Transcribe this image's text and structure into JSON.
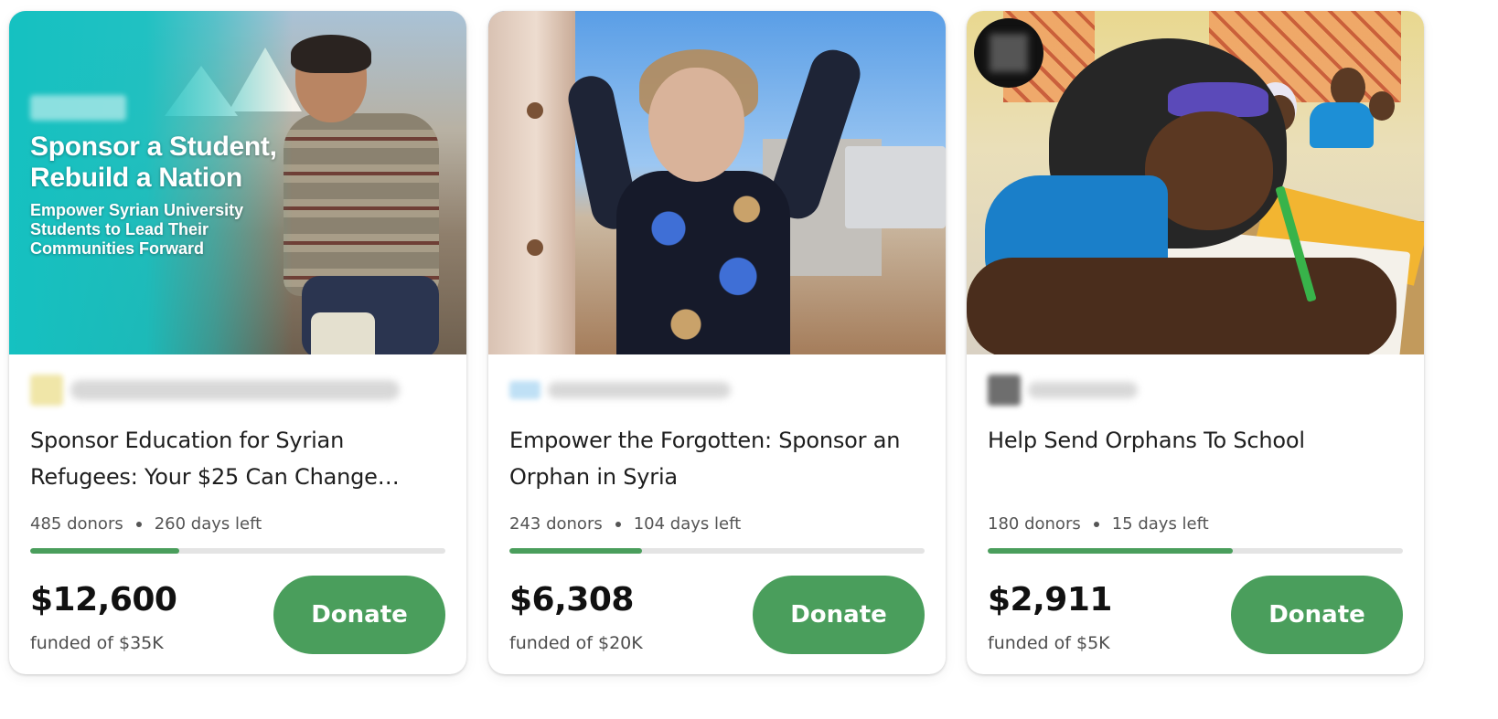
{
  "colors": {
    "accent_green": "#4a9e5c",
    "progress_track": "#e4e4e4",
    "teal": "#15c1c1"
  },
  "cards": [
    {
      "promo_title": "Sponsor a Student, Rebuild a Nation",
      "promo_subtitle": "Empower Syrian University Students to Lead Their Communities Forward",
      "title": "Sponsor Education for Syrian Refugees: Your $25 Can Change…",
      "donors": "485 donors",
      "days_left": "260 days left",
      "progress_fraction": 0.36,
      "amount": "$12,600",
      "goal": "funded of $35K",
      "donate_label": "Donate"
    },
    {
      "title": "Empower the Forgotten: Sponsor an Orphan in Syria",
      "donors": "243 donors",
      "days_left": "104 days left",
      "progress_fraction": 0.32,
      "amount": "$6,308",
      "goal": "funded of $20K",
      "donate_label": "Donate"
    },
    {
      "title": "Help Send Orphans To School",
      "donors": "180 donors",
      "days_left": "15 days left",
      "progress_fraction": 0.59,
      "amount": "$2,911",
      "goal": "funded of $5K",
      "donate_label": "Donate"
    }
  ]
}
